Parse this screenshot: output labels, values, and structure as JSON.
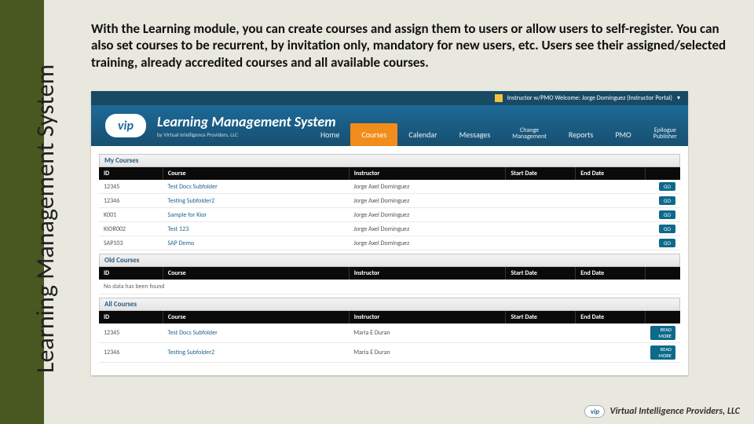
{
  "side_title": "Learning Management System",
  "intro": "With the Learning module, you can create courses and assign them to users or allow users to self-register. You can also set courses to be recurrent, by invitation only, mandatory for new users, etc. Users see their assigned/selected training, already accredited courses and all available courses.",
  "topbar": {
    "welcome": "Instructor w/PMO Welcome: Jorge Dominguez (Instructor Portal)"
  },
  "brand": {
    "logo": "vip",
    "title": "Learning Management System",
    "subtitle": "by Virtual Intelligence Providers, LLC"
  },
  "nav": [
    "Home",
    "Courses",
    "Calendar",
    "Messages",
    "Change Management",
    "Reports",
    "PMO",
    "Epilogue Publisher"
  ],
  "nav_active": 1,
  "sections": {
    "my": {
      "title": "My Courses",
      "columns": [
        "ID",
        "Course",
        "Instructor",
        "Start Date",
        "End Date",
        ""
      ],
      "rows": [
        {
          "id": "12345",
          "course": "Test Docs Subfolder",
          "instructor": "Jorge Axel Dominguez",
          "start": "",
          "end": "",
          "act": "GO"
        },
        {
          "id": "12346",
          "course": "Testing Subfolder2",
          "instructor": "Jorge Axel Dominguez",
          "start": "",
          "end": "",
          "act": "GO"
        },
        {
          "id": "K001",
          "course": "Sample for Kior",
          "instructor": "Jorge Axel Dominguez",
          "start": "",
          "end": "",
          "act": "GO"
        },
        {
          "id": "KIOR002",
          "course": "Test 123",
          "instructor": "Jorge Axel Dominguez",
          "start": "",
          "end": "",
          "act": "GO"
        },
        {
          "id": "SAP103",
          "course": "SAP Demo",
          "instructor": "Jorge Axel Dominguez",
          "start": "",
          "end": "",
          "act": "GO"
        }
      ]
    },
    "old": {
      "title": "Old Courses",
      "columns": [
        "ID",
        "Course",
        "Instructor",
        "Start Date",
        "End Date",
        ""
      ],
      "empty": "No data has been found"
    },
    "all": {
      "title": "All Courses",
      "columns": [
        "ID",
        "Course",
        "Instructor",
        "Start Date",
        "End Date",
        ""
      ],
      "rows": [
        {
          "id": "12345",
          "course": "Test Docs Subfolder",
          "instructor": "Maria E Duran",
          "start": "",
          "end": "",
          "act": "READ MORE"
        },
        {
          "id": "12346",
          "course": "Testing Subfolder2",
          "instructor": "Maria E Duran",
          "start": "",
          "end": "",
          "act": "READ MORE"
        }
      ]
    }
  },
  "footer": {
    "logo": "vip",
    "text": "Virtual Intelligence Providers, LLC"
  }
}
